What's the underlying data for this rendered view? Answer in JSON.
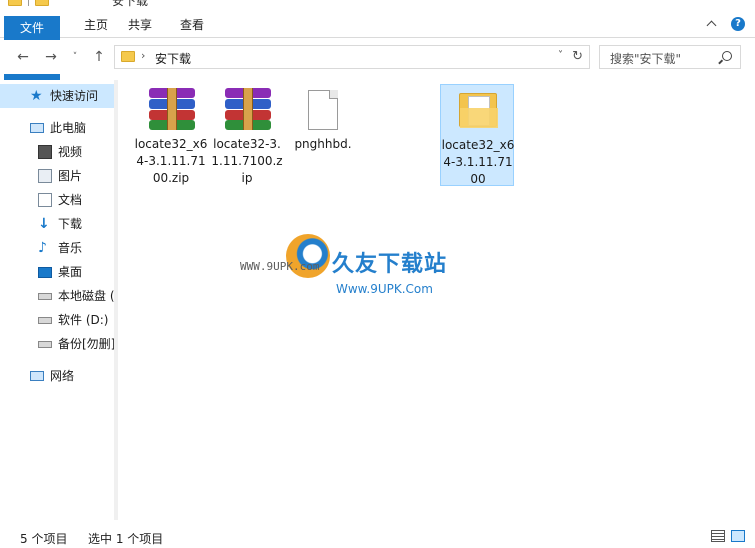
{
  "window": {
    "title": "安下载"
  },
  "ribbon": {
    "tabs": [
      "文件",
      "主页",
      "共享",
      "查看"
    ]
  },
  "address": {
    "path_segment": "安下载",
    "search_placeholder": "搜索\"安下载\""
  },
  "sidebar": {
    "items": [
      {
        "label": "快速访问",
        "icon": "star-icon"
      },
      {
        "label": "此电脑",
        "icon": "computer-icon"
      },
      {
        "label": "视频",
        "icon": "video-icon"
      },
      {
        "label": "图片",
        "icon": "pictures-icon"
      },
      {
        "label": "文档",
        "icon": "documents-icon"
      },
      {
        "label": "下载",
        "icon": "download-icon"
      },
      {
        "label": "音乐",
        "icon": "music-icon"
      },
      {
        "label": "桌面",
        "icon": "desktop-icon"
      },
      {
        "label": "本地磁盘 (",
        "icon": "local-disk-icon"
      },
      {
        "label": "软件 (D:)",
        "icon": "drive-icon"
      },
      {
        "label": "备份[勿删]",
        "icon": "drive-icon"
      },
      {
        "label": "网络",
        "icon": "network-icon"
      }
    ]
  },
  "files": [
    {
      "name": "locate32_x64-3.1.11.7100.zip",
      "icon": "winrar-archive-icon",
      "selected": false
    },
    {
      "name": "locate32-3.1.11.7100.zip",
      "icon": "winrar-archive-icon",
      "selected": false
    },
    {
      "name": "pnghhbd.",
      "icon": "blank-file-icon",
      "selected": false
    },
    {
      "name": "locate32_x64-3.1.11.7100",
      "icon": "folder-icon",
      "selected": true
    }
  ],
  "watermark": {
    "url": "WWW.9UPK.com",
    "title": "久友下载站",
    "subtitle": "Www.9UPK.Com"
  },
  "status": {
    "item_count": "5 个项目",
    "selection": "选中 1 个项目"
  },
  "colors": {
    "accent": "#1979ca",
    "selection": "#cce8ff"
  }
}
